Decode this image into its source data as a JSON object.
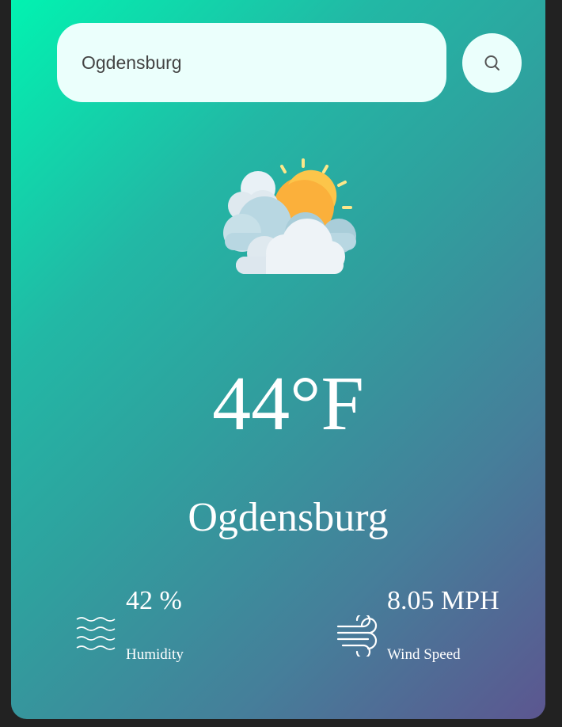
{
  "search": {
    "value": "Ogdensburg",
    "icon": "search-icon"
  },
  "weather": {
    "icon": "partly-cloudy-icon",
    "temperature": "44°F",
    "city": "Ogdensburg"
  },
  "details": {
    "humidity": {
      "icon": "humidity-waves-icon",
      "value": "42 %",
      "label": "Humidity"
    },
    "wind": {
      "icon": "wind-icon",
      "value": "8.05 MPH",
      "label": "Wind Speed"
    }
  },
  "colors": {
    "background": "#222222",
    "gradient_start": "#00f5b1",
    "gradient_end": "#5c5690",
    "input_background": "#ebfffc",
    "text": "#ffffff"
  }
}
